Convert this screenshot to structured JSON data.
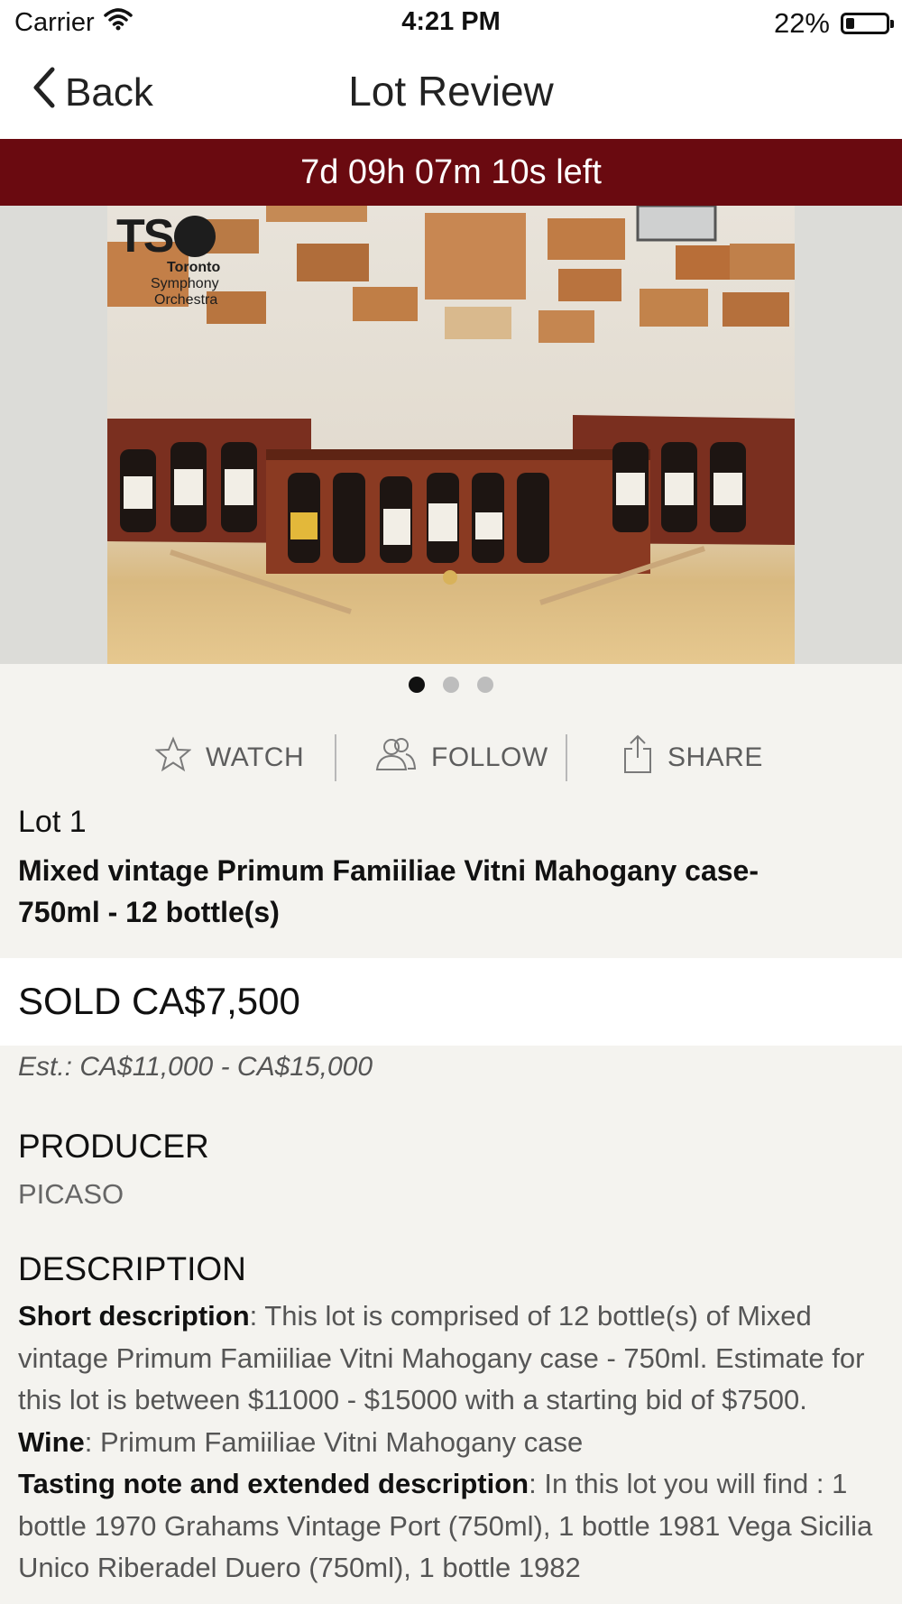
{
  "status_bar": {
    "carrier": "Carrier",
    "time": "4:21 PM",
    "battery": "22%",
    "battery_level": 0.22
  },
  "nav": {
    "back_label": "Back",
    "title": "Lot Review"
  },
  "countdown": "7d 09h 07m 10s left",
  "gallery": {
    "logo_text": "TS",
    "logo_lines": [
      "Toronto",
      "Symphony",
      "Orchestra"
    ],
    "page_count": 3,
    "active_page": 1
  },
  "actions": {
    "watch": "WATCH",
    "follow": "FOLLOW",
    "share": "SHARE"
  },
  "lot": {
    "number": "Lot 1",
    "title": "Mixed vintage Primum Famiiliae Vitni Mahogany case-750ml - 12 bottle(s)",
    "sold": "SOLD CA$7,500",
    "estimate": "Est.: CA$11,000 - CA$15,000"
  },
  "producer": {
    "heading": "PRODUCER",
    "value": "PICASO"
  },
  "description": {
    "heading": "DESCRIPTION",
    "short_label": "Short description",
    "short_text": ": This lot is comprised of 12 bottle(s) of Mixed vintage Primum Famiiliae Vitni Mahogany case - 750ml. Estimate for this lot is between $11000 - $15000 with a starting bid of $7500.",
    "wine_label": "Wine",
    "wine_text": ": Primum Famiiliae Vitni Mahogany case",
    "tasting_label": "Tasting note and extended description",
    "tasting_text": ": In this lot you will find : 1 bottle 1970 Grahams Vintage Port (750ml), 1 bottle 1981 Vega Sicilia Unico Riberadel Duero (750ml), 1 bottle 1982"
  },
  "colors": {
    "banner": "#6a0a10",
    "background": "#f4f3ef"
  }
}
